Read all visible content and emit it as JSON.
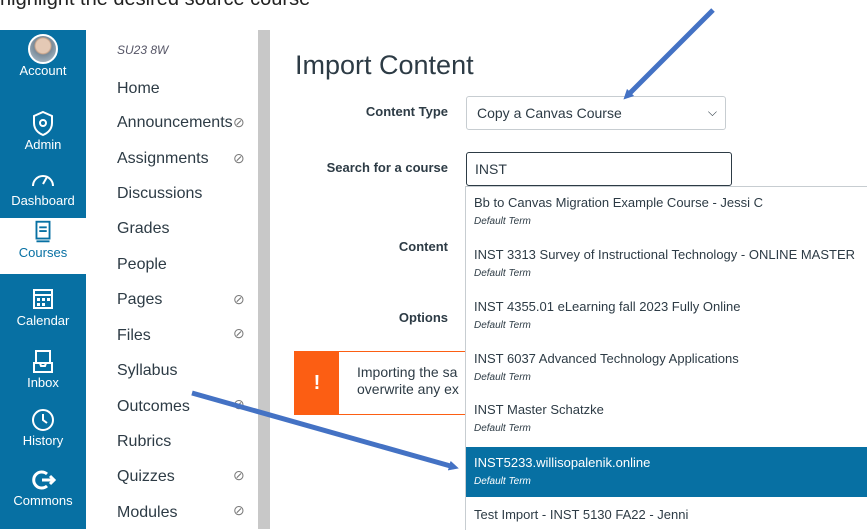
{
  "caption": "highlight the desired source course",
  "global_nav": [
    {
      "label": "Account",
      "icon": "avatar"
    },
    {
      "label": "Admin",
      "icon": "shield-icon"
    },
    {
      "label": "Dashboard",
      "icon": "speedometer-icon"
    },
    {
      "label": "Courses",
      "icon": "book-icon",
      "active": true
    },
    {
      "label": "Calendar",
      "icon": "calendar-icon"
    },
    {
      "label": "Inbox",
      "icon": "inbox-icon"
    },
    {
      "label": "History",
      "icon": "clock-icon"
    },
    {
      "label": "Commons",
      "icon": "commons-icon"
    }
  ],
  "course_nav": {
    "term": "SU23 8W",
    "items": [
      {
        "label": "Home",
        "hidden": false
      },
      {
        "label": "Announcements",
        "hidden": true
      },
      {
        "label": "Assignments",
        "hidden": true
      },
      {
        "label": "Discussions",
        "hidden": false
      },
      {
        "label": "Grades",
        "hidden": false
      },
      {
        "label": "People",
        "hidden": false
      },
      {
        "label": "Pages",
        "hidden": true
      },
      {
        "label": "Files",
        "hidden": true
      },
      {
        "label": "Syllabus",
        "hidden": false
      },
      {
        "label": "Outcomes",
        "hidden": true
      },
      {
        "label": "Rubrics",
        "hidden": false
      },
      {
        "label": "Quizzes",
        "hidden": true
      },
      {
        "label": "Modules",
        "hidden": true
      }
    ]
  },
  "main": {
    "title": "Import Content",
    "content_type_label": "Content Type",
    "content_type_value": "Copy a Canvas Course",
    "search_label": "Search for a course",
    "search_value": "INST",
    "content_label": "Content",
    "options_label": "Options",
    "warning_icon": "!",
    "warning_line1": "Importing the sa",
    "warning_line2": "overwrite any ex"
  },
  "dropdown": {
    "term_label": "Default Term",
    "options": [
      {
        "name": "Bb to Canvas Migration Example Course - Jessi C",
        "selected": false
      },
      {
        "name": "INST 3313 Survey of Instructional Technology - ONLINE MASTER",
        "selected": false
      },
      {
        "name": "INST 4355.01 eLearning fall 2023 Fully Online",
        "selected": false
      },
      {
        "name": "INST 6037 Advanced Technology Applications",
        "selected": false
      },
      {
        "name": "INST Master Schatzke",
        "selected": false
      },
      {
        "name": "INST5233.willisopalenik.online",
        "selected": true
      },
      {
        "name": "Test Import - INST 5130 FA22 - Jenni",
        "selected": false
      }
    ]
  },
  "colors": {
    "nav_bg": "#0770a3",
    "warning": "#fc5e13",
    "selected_bg": "#0770a3",
    "arrow": "#4472c4"
  }
}
